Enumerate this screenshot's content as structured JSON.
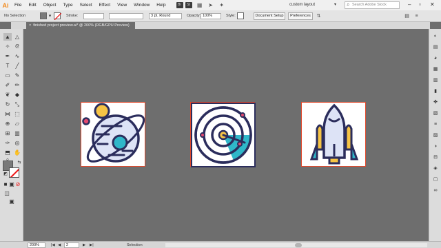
{
  "app": {
    "logo": "Ai"
  },
  "menu": [
    "File",
    "Edit",
    "Object",
    "Type",
    "Select",
    "Effect",
    "View",
    "Window",
    "Help"
  ],
  "menu_badges": [
    "Br",
    "St"
  ],
  "workspace": "custom layout",
  "search_placeholder": "Search Adobe Stock",
  "control": {
    "selection_label": "No Selection",
    "stroke_label": "Stroke:",
    "brush_value": "3 pt. Round",
    "opacity_label": "Opacity:",
    "opacity_value": "100%",
    "style_label": "Style:",
    "doc_setup": "Document Setup",
    "preferences": "Preferences"
  },
  "doc_tab": "finished project preview.ai* @ 200% (RGB/GPU Preview)",
  "status": {
    "zoom": "200%",
    "page": "2",
    "tool": "Selection"
  },
  "icons": [
    {
      "name": "planet"
    },
    {
      "name": "radar"
    },
    {
      "name": "rocket"
    }
  ],
  "colors": {
    "outline": "#2b2d5c",
    "teal": "#2fb7c9",
    "yellow": "#f6c445",
    "pale_blue": "#dde3f6",
    "pink": "#e2496e",
    "border": "#e2492c"
  }
}
